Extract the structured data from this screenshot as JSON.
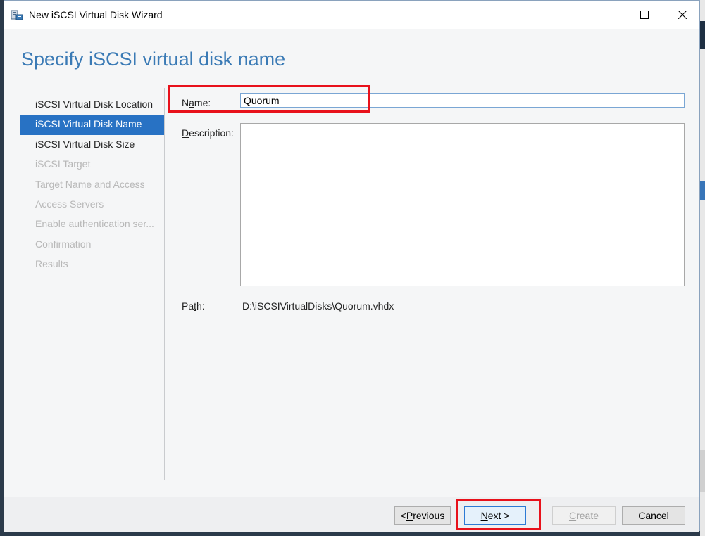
{
  "window": {
    "title": "New iSCSI Virtual Disk Wizard",
    "heading": "Specify iSCSI virtual disk name"
  },
  "nav": {
    "items": [
      {
        "label": "iSCSI Virtual Disk Location",
        "state": "enabled"
      },
      {
        "label": "iSCSI Virtual Disk Name",
        "state": "active"
      },
      {
        "label": "iSCSI Virtual Disk Size",
        "state": "enabled"
      },
      {
        "label": "iSCSI Target",
        "state": "disabled"
      },
      {
        "label": "Target Name and Access",
        "state": "disabled"
      },
      {
        "label": "Access Servers",
        "state": "disabled"
      },
      {
        "label": "Enable authentication ser...",
        "state": "disabled"
      },
      {
        "label": "Confirmation",
        "state": "disabled"
      },
      {
        "label": "Results",
        "state": "disabled"
      }
    ]
  },
  "form": {
    "name_label_pre": "N",
    "name_label_ul": "a",
    "name_label_post": "me:",
    "name_value": "Quorum",
    "description_label_ul": "D",
    "description_label_post": "escription:",
    "description_value": "",
    "path_label_pre": "Pa",
    "path_label_ul": "t",
    "path_label_post": "h:",
    "path_value": "D:\\iSCSIVirtualDisks\\Quorum.vhdx"
  },
  "buttons": {
    "previous_pre": "< ",
    "previous_ul": "P",
    "previous_post": "revious",
    "next_ul": "N",
    "next_post": "ext >",
    "create_ul": "C",
    "create_post": "reate",
    "cancel": "Cancel"
  },
  "colors": {
    "heading": "#3a7ab5",
    "nav_active": "#2872c4",
    "highlight": "#e8111b"
  },
  "icons": [
    "app-icon",
    "minimize-icon",
    "maximize-icon",
    "close-icon"
  ]
}
